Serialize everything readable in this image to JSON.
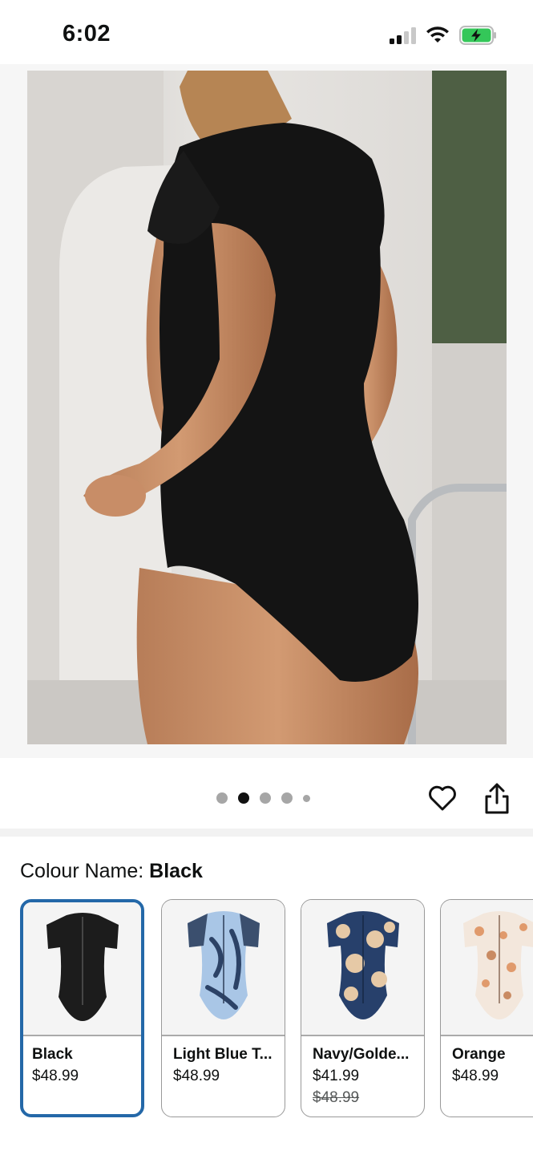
{
  "status": {
    "time": "6:02"
  },
  "product": {
    "image_alt": "Black short-sleeve one-piece swimsuit, back view",
    "image_index": 2,
    "image_count": 5
  },
  "colour": {
    "label": "Colour Name: ",
    "selected": "Black"
  },
  "swatches": [
    {
      "name": "Black",
      "price": "$48.99",
      "old_price": "",
      "selected": true,
      "color": "#1c1c1c"
    },
    {
      "name": "Light Blue T...",
      "price": "$48.99",
      "old_price": "",
      "selected": false,
      "color": "#a9c6e6"
    },
    {
      "name": "Navy/Golde...",
      "price": "$41.99",
      "old_price": "$48.99",
      "selected": false,
      "color": "#27406b"
    },
    {
      "name": "Orange",
      "price": "$48.99",
      "old_price": "",
      "selected": false,
      "color": "#e3b493"
    }
  ],
  "colors": {
    "selected_border": "#2468a8",
    "battery": "#34c759"
  }
}
